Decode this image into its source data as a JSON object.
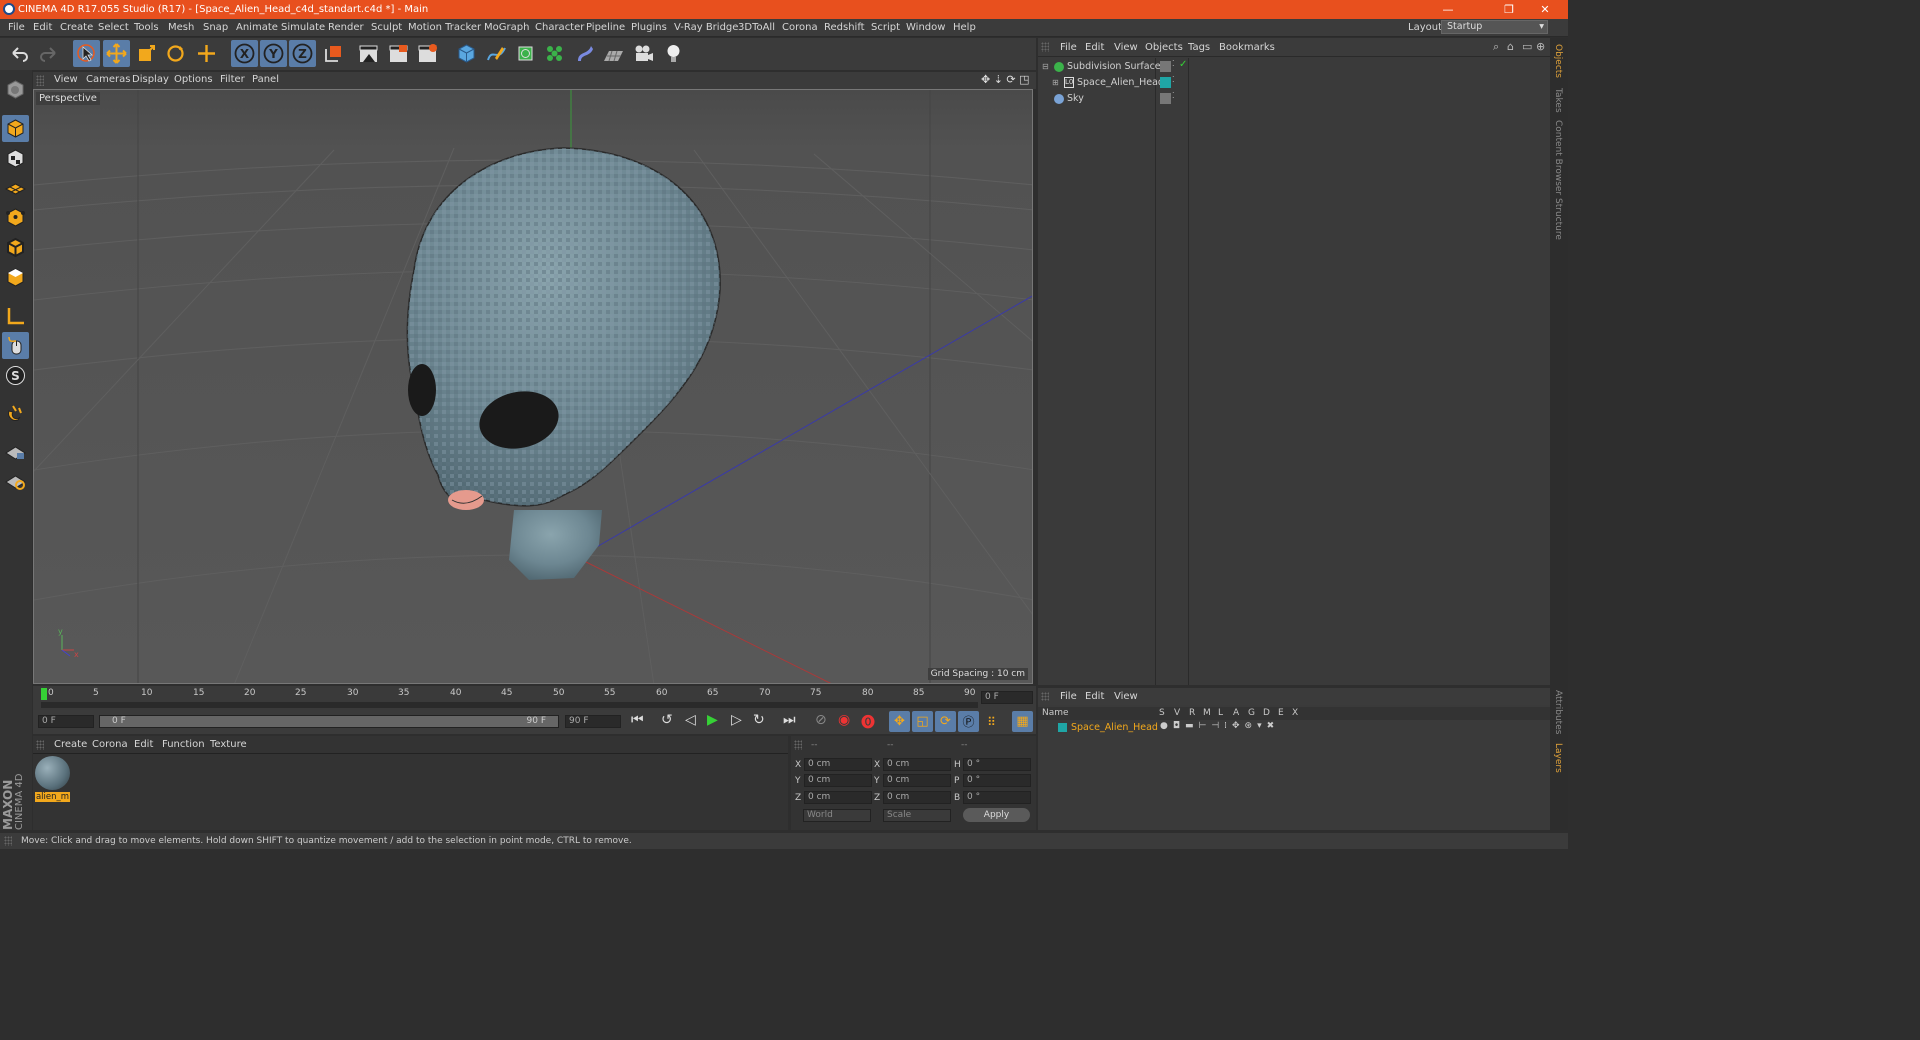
{
  "window": {
    "title": "CINEMA 4D R17.055 Studio (R17) - [Space_Alien_Head_c4d_standart.c4d *] - Main",
    "min": "—",
    "max": "❐",
    "close": "✕"
  },
  "menu": [
    "File",
    "Edit",
    "Create",
    "Select",
    "Tools",
    "Mesh",
    "Snap",
    "Animate",
    "Simulate",
    "Render",
    "Sculpt",
    "Motion Tracker",
    "MoGraph",
    "Character",
    "Pipeline",
    "Plugins",
    "V-Ray Bridge",
    "3DToAll",
    "Corona",
    "Redshift",
    "Script",
    "Window",
    "Help"
  ],
  "layout": {
    "label": "Layout:",
    "value": "Startup"
  },
  "viewport": {
    "menu": [
      "View",
      "Cameras",
      "Display",
      "Options",
      "Filter",
      "Panel"
    ],
    "name": "Perspective",
    "grid_spacing": "Grid Spacing : 10 cm"
  },
  "timeline": {
    "ticks": [
      "0",
      "5",
      "10",
      "15",
      "20",
      "25",
      "30",
      "35",
      "40",
      "45",
      "50",
      "55",
      "60",
      "65",
      "70",
      "75",
      "80",
      "85",
      "90"
    ],
    "current_frame": "0 F"
  },
  "playbar": {
    "start": "0 F",
    "range_start": "0 F",
    "range_end": "90 F",
    "end": "90 F"
  },
  "material_panel": {
    "menu": [
      "Create",
      "Corona",
      "Edit",
      "Function",
      "Texture"
    ],
    "material_name": "alien_m"
  },
  "coords": {
    "header": [
      "--",
      "--",
      "--"
    ],
    "rows": [
      {
        "a": "X",
        "av": "0 cm",
        "b": "X",
        "bv": "0 cm",
        "c": "H",
        "cv": "0 °"
      },
      {
        "a": "Y",
        "av": "0 cm",
        "b": "Y",
        "bv": "0 cm",
        "c": "P",
        "cv": "0 °"
      },
      {
        "a": "Z",
        "av": "0 cm",
        "b": "Z",
        "bv": "0 cm",
        "c": "B",
        "cv": "0 °"
      }
    ],
    "world": "World",
    "scale": "Scale",
    "apply": "Apply"
  },
  "objects": {
    "menu": [
      "File",
      "Edit",
      "View",
      "Objects",
      "Tags",
      "Bookmarks"
    ],
    "items": [
      {
        "name": "Subdivision Surface"
      },
      {
        "name": "Space_Alien_Head"
      },
      {
        "name": "Sky"
      }
    ]
  },
  "layers": {
    "menu": [
      "File",
      "Edit",
      "View"
    ],
    "name_header": "Name",
    "columns": [
      "S",
      "V",
      "R",
      "M",
      "L",
      "A",
      "G",
      "D",
      "E",
      "X"
    ],
    "row": "Space_Alien_Head"
  },
  "right_tabs": [
    "Objects",
    "Takes",
    "Content Browser",
    "Structure"
  ],
  "right_tabs_bottom": [
    "Attributes",
    "Layers"
  ],
  "brand": {
    "maxon": "MAXON",
    "c4d": "CINEMA 4D"
  },
  "status": "Move: Click and drag to move elements. Hold down SHIFT to quantize movement / add to the selection in point mode, CTRL to remove.",
  "colors": {
    "title": "#e8501e",
    "accent": "#5a7da8",
    "active_tab": "#e0a23a",
    "alien": "#6f8a96"
  }
}
